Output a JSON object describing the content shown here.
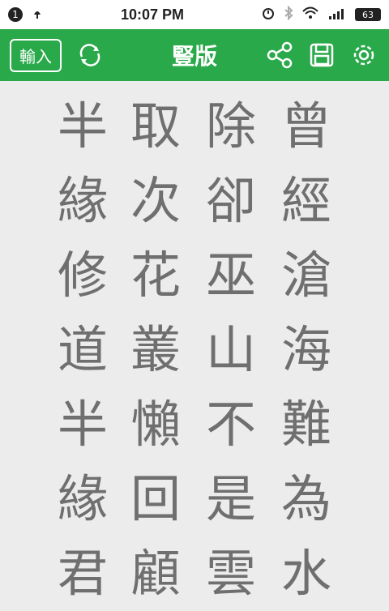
{
  "status_bar": {
    "notification_count": "1",
    "time": "10:07 PM",
    "battery": "63"
  },
  "toolbar": {
    "input_label": "輸入",
    "title": "豎版",
    "icons": [
      "refresh-icon",
      "share-icon",
      "save-icon",
      "settings-icon"
    ]
  },
  "columns": [
    [
      "曾",
      "經",
      "滄",
      "海",
      "難",
      "為",
      "水"
    ],
    [
      "除",
      "卻",
      "巫",
      "山",
      "不",
      "是",
      "雲"
    ],
    [
      "取",
      "次",
      "花",
      "叢",
      "懶",
      "回",
      "顧"
    ],
    [
      "半",
      "緣",
      "修",
      "道",
      "半",
      "緣",
      "君"
    ]
  ],
  "colors": {
    "accent": "#2aa94a",
    "text": "#6f6f6f"
  }
}
